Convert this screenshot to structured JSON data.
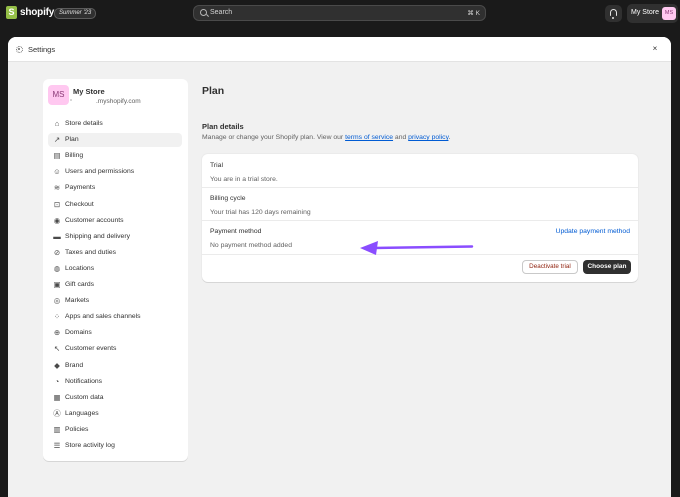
{
  "topbar": {
    "logo_text": "shopify",
    "edition": "Summer '23",
    "search_placeholder": "Search",
    "search_shortcut": "⌘ K",
    "store_name": "My Store",
    "store_initials": "MS"
  },
  "settings": {
    "title": "Settings",
    "close": "×"
  },
  "nav": {
    "store_name": "My Store",
    "store_domain": ".myshopify.com",
    "store_initials": "MS",
    "items": [
      {
        "label": "Store details",
        "icon": "store-icon",
        "glyph": "⌂"
      },
      {
        "label": "Plan",
        "icon": "plan-icon",
        "glyph": "↗"
      },
      {
        "label": "Billing",
        "icon": "billing-icon",
        "glyph": "▤"
      },
      {
        "label": "Users and permissions",
        "icon": "users-icon",
        "glyph": "☺"
      },
      {
        "label": "Payments",
        "icon": "payments-icon",
        "glyph": "≋"
      },
      {
        "label": "Checkout",
        "icon": "cart-icon",
        "glyph": "⊡"
      },
      {
        "label": "Customer accounts",
        "icon": "customer-icon",
        "glyph": "◉"
      },
      {
        "label": "Shipping and delivery",
        "icon": "truck-icon",
        "glyph": "▬"
      },
      {
        "label": "Taxes and duties",
        "icon": "tax-icon",
        "glyph": "⊘"
      },
      {
        "label": "Locations",
        "icon": "location-icon",
        "glyph": "◍"
      },
      {
        "label": "Gift cards",
        "icon": "gift-icon",
        "glyph": "▣"
      },
      {
        "label": "Markets",
        "icon": "globe-icon",
        "glyph": "◎"
      },
      {
        "label": "Apps and sales channels",
        "icon": "apps-icon",
        "glyph": "⁘"
      },
      {
        "label": "Domains",
        "icon": "domain-icon",
        "glyph": "⊕"
      },
      {
        "label": "Customer events",
        "icon": "cursor-icon",
        "glyph": "↖"
      },
      {
        "label": "Brand",
        "icon": "brand-icon",
        "glyph": "◆"
      },
      {
        "label": "Notifications",
        "icon": "bell-icon",
        "glyph": "◔"
      },
      {
        "label": "Custom data",
        "icon": "data-icon",
        "glyph": "▦"
      },
      {
        "label": "Languages",
        "icon": "language-icon",
        "glyph": "Ⓐ"
      },
      {
        "label": "Policies",
        "icon": "policy-icon",
        "glyph": "▥"
      },
      {
        "label": "Store activity log",
        "icon": "list-icon",
        "glyph": "☰"
      }
    ],
    "active_index": 1
  },
  "main": {
    "title": "Plan",
    "section_title": "Plan details",
    "desc_prefix": "Manage or change your Shopify plan. View our ",
    "desc_link1": "terms of service",
    "desc_mid": " and ",
    "desc_link2": "privacy policy",
    "desc_suffix": ".",
    "trial_title": "Trial",
    "trial_sub": "You are in a trial store.",
    "billing_title": "Billing cycle",
    "billing_sub": "Your trial has 120 days remaining",
    "payment_title": "Payment method",
    "payment_sub": "No payment method added",
    "payment_link": "Update payment method",
    "deactivate_label": "Deactivate trial",
    "choose_label": "Choose plan"
  },
  "colors": {
    "arrow": "#8a4dff",
    "accent_link": "#005bd3",
    "avatar_bg": "#ffc8f0"
  }
}
